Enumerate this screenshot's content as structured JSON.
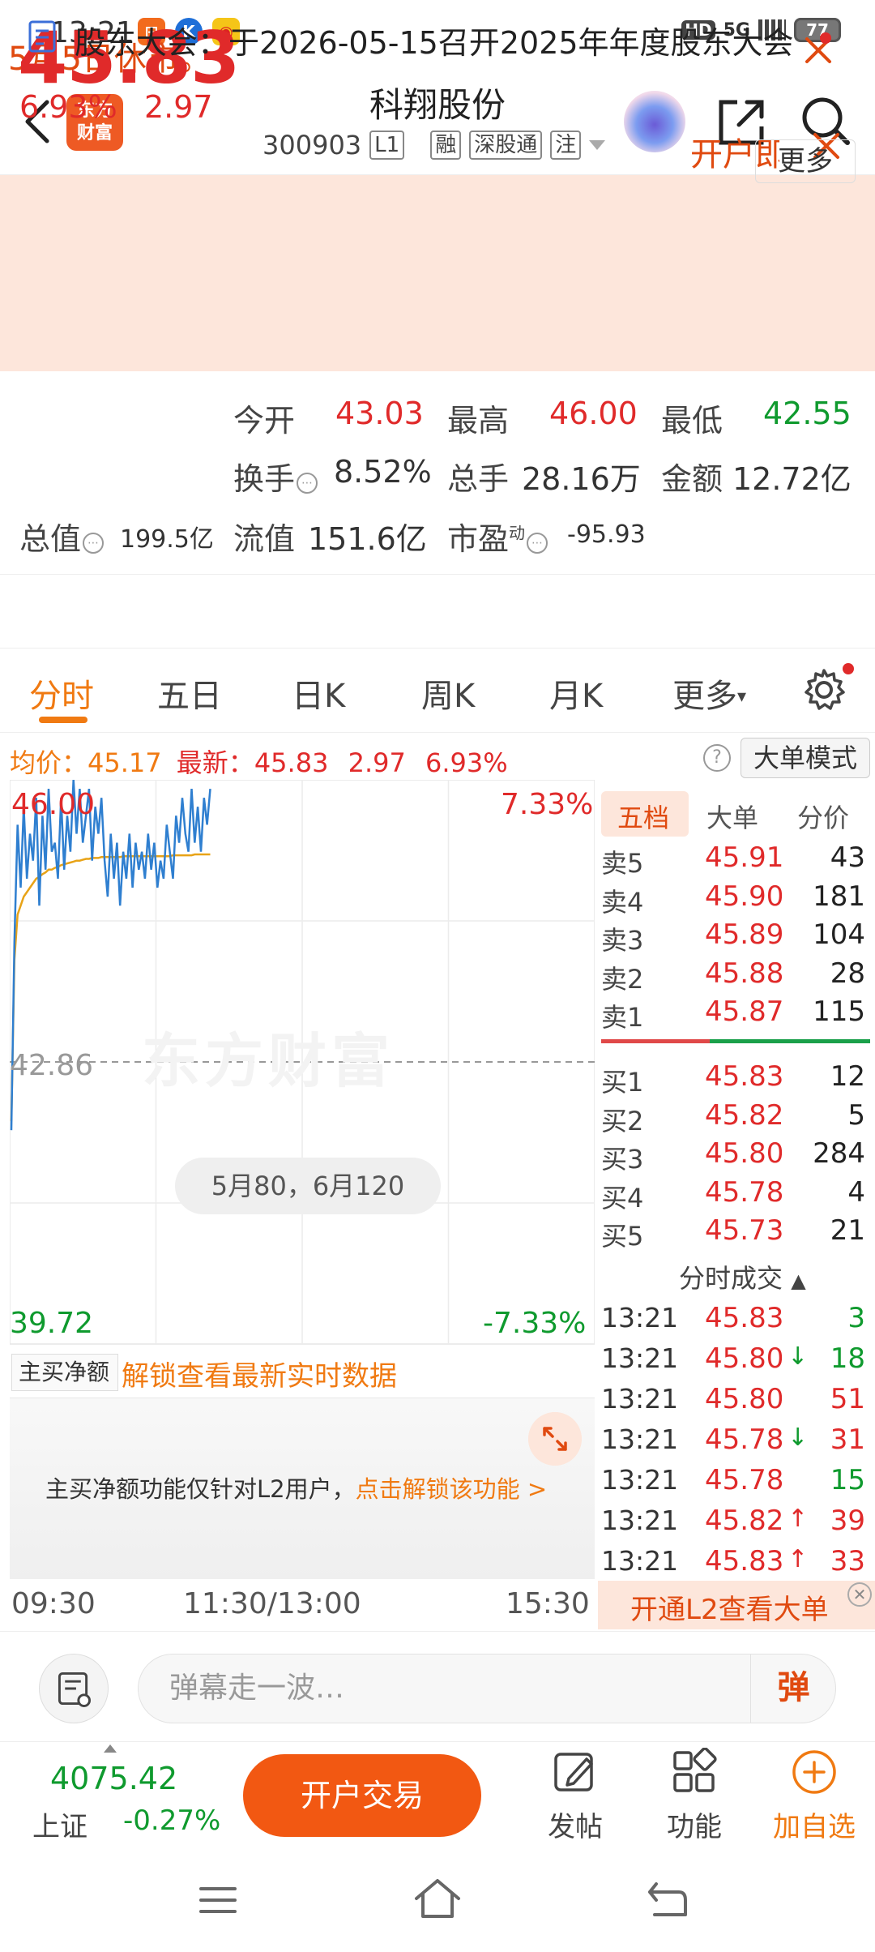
{
  "status_bar": {
    "time": "13:21",
    "network": "HD",
    "signal": "5G",
    "battery": "77"
  },
  "header": {
    "brand_line1": "东方",
    "brand_line2": "财富",
    "stock_name": "科翔股份",
    "stock_code": "300903",
    "tag_level": "L1",
    "tag_margin": "融",
    "tag_connect": "深股通",
    "tag_note": "注"
  },
  "banner": {
    "message": "5月5日休市。",
    "promo": "开户即"
  },
  "quote": {
    "price": "45.83",
    "change_pct": "6.93%",
    "change_val": "2.97",
    "open_label": "今开",
    "open": "43.03",
    "high_label": "最高",
    "high": "46.00",
    "low_label": "最低",
    "low": "42.55",
    "turnover_label": "换手",
    "turnover": "8.52%",
    "volume_label": "总手",
    "volume": "28.16万",
    "amount_label": "金额",
    "amount": "12.72亿",
    "mktcap_label": "总值",
    "mktcap": "199.5亿",
    "float_label": "流值",
    "float": "151.6亿",
    "pe_label": "市盈",
    "pe_sup": "动",
    "pe": "-95.93",
    "more_label": "更多"
  },
  "news": {
    "text": "股东大会：于2026-05-15召开2025年年度股东大会"
  },
  "tabs": [
    {
      "label": "分时"
    },
    {
      "label": "五日"
    },
    {
      "label": "日K"
    },
    {
      "label": "周K"
    },
    {
      "label": "月K"
    },
    {
      "label": "更多"
    }
  ],
  "avg_line": {
    "avg_label": "均价：",
    "avg": "45.17",
    "latest_label": "最新：",
    "latest": "45.83",
    "change_val": "2.97",
    "change_pct": "6.93%",
    "help": "?",
    "mode_button": "大单模式"
  },
  "chart": {
    "y_top": "46.00",
    "y_mid": "42.86",
    "y_bottom": "39.72",
    "pct_top": "7.33%",
    "pct_bottom": "-7.33%",
    "watermark": "东方财富",
    "date_hint": "5月80，6月120",
    "time_start": "09:30",
    "time_mid": "11:30/13:00",
    "time_end": "15:30"
  },
  "chart_data": {
    "type": "line",
    "ylim": [
      39.72,
      46.0
    ],
    "pre_close": 42.86,
    "series": [
      {
        "values": [
          42.1,
          44.2,
          45.5,
          44.8,
          45.7,
          44.9,
          45.4,
          45.1,
          45.8,
          44.6,
          45.6,
          45.0,
          45.9,
          45.2,
          45.3,
          44.9,
          45.8,
          45.0,
          45.6,
          45.2,
          46.0,
          45.4,
          45.9,
          45.3,
          45.6,
          45.9,
          45.1,
          45.7,
          45.4,
          45.8,
          45.1,
          44.7,
          45.4,
          44.9,
          45.3,
          44.6,
          45.2,
          44.9,
          45.4,
          44.8,
          45.3,
          45.0,
          45.2,
          44.9,
          45.4,
          45.0,
          45.3,
          44.8,
          45.1,
          44.9,
          45.5,
          45.2,
          44.9,
          45.6,
          45.3,
          45.8,
          45.4,
          45.2,
          45.9,
          45.3,
          45.7,
          45.2,
          45.8,
          45.5,
          45.9
        ]
      },
      {
        "values": [
          42.2,
          44.0,
          44.5,
          44.6,
          44.7,
          44.75,
          44.8,
          44.85,
          44.9,
          44.92,
          44.95,
          44.97,
          45.0,
          45.0,
          45.02,
          45.03,
          45.05,
          45.06,
          45.07,
          45.08,
          45.09,
          45.1,
          45.1,
          45.11,
          45.12,
          45.12,
          45.13,
          45.13,
          45.13,
          45.14,
          45.14,
          45.14,
          45.14,
          45.14,
          45.14,
          45.14,
          45.15,
          45.15,
          45.15,
          45.15,
          45.15,
          45.15,
          45.15,
          45.15,
          45.15,
          45.15,
          45.15,
          45.15,
          45.15,
          45.15,
          45.15,
          45.15,
          45.16,
          45.16,
          45.16,
          45.16,
          45.16,
          45.16,
          45.16,
          45.17,
          45.17,
          45.17,
          45.17,
          45.17,
          45.17
        ]
      }
    ]
  },
  "orderbook": {
    "tabs": [
      "五档",
      "大单",
      "分价"
    ],
    "sell": [
      {
        "label": "卖5",
        "price": "45.91",
        "vol": "43"
      },
      {
        "label": "卖4",
        "price": "45.90",
        "vol": "181"
      },
      {
        "label": "卖3",
        "price": "45.89",
        "vol": "104"
      },
      {
        "label": "卖2",
        "price": "45.88",
        "vol": "28"
      },
      {
        "label": "卖1",
        "price": "45.87",
        "vol": "115"
      }
    ],
    "buy": [
      {
        "label": "买1",
        "price": "45.83",
        "vol": "12"
      },
      {
        "label": "买2",
        "price": "45.82",
        "vol": "5"
      },
      {
        "label": "买3",
        "price": "45.80",
        "vol": "284"
      },
      {
        "label": "买4",
        "price": "45.78",
        "vol": "4"
      },
      {
        "label": "买5",
        "price": "45.73",
        "vol": "21"
      }
    ],
    "trades_title": "分时成交",
    "trades": [
      {
        "time": "13:21",
        "price": "45.83",
        "arrow": "",
        "vol": "3",
        "color": "#0f9a2e"
      },
      {
        "time": "13:21",
        "price": "45.80",
        "arrow": "↓",
        "vol": "18",
        "color": "#0f9a2e"
      },
      {
        "time": "13:21",
        "price": "45.80",
        "arrow": "",
        "vol": "51",
        "color": "#e02a2a"
      },
      {
        "time": "13:21",
        "price": "45.78",
        "arrow": "↓",
        "vol": "31",
        "color": "#e02a2a"
      },
      {
        "time": "13:21",
        "price": "45.78",
        "arrow": "",
        "vol": "15",
        "color": "#0f9a2e"
      },
      {
        "time": "13:21",
        "price": "45.82",
        "arrow": "↑",
        "vol": "39",
        "color": "#e02a2a"
      },
      {
        "time": "13:21",
        "price": "45.83",
        "arrow": "↑",
        "vol": "33",
        "color": "#e02a2a"
      }
    ],
    "open_l2": "开通L2查看大单"
  },
  "netbuy": {
    "select_label": "主买净额",
    "unlock": "解锁查看最新实时数据",
    "l2_text": "主买净额功能仅针对L2用户，",
    "l2_link": "点击解锁该功能 >"
  },
  "danmaku": {
    "placeholder": "弹幕走一波…",
    "send": "弹"
  },
  "bottom_bar": {
    "index_value": "4075.42",
    "index_name": "上证",
    "index_change": "-0.27%",
    "trade_button": "开户交易",
    "post": "发帖",
    "function": "功能",
    "watchlist": "加自选"
  },
  "colors": {
    "up": "#e02a2a",
    "down": "#0f9a2e",
    "accent": "#f07a12",
    "price_line": "#2f7fd0",
    "avg_line": "#e8a317"
  }
}
